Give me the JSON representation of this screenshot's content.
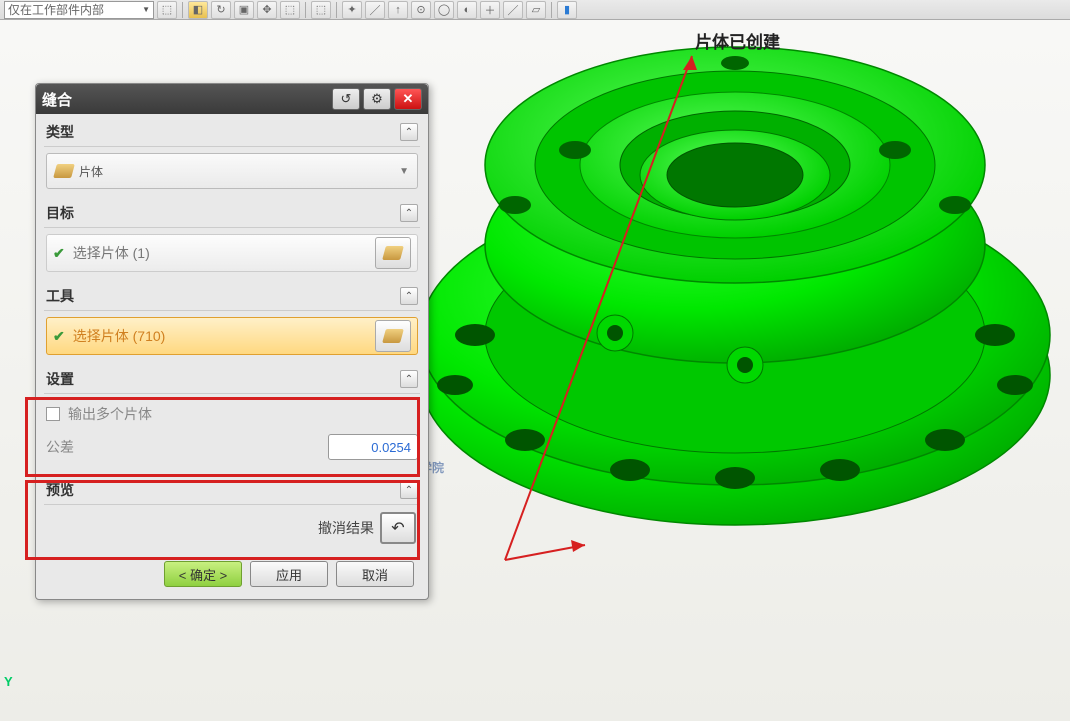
{
  "toolbar": {
    "dropdown_text": "仅在工作部件内部"
  },
  "viewport": {
    "status_text": "片体已创建",
    "axis_label": "Y"
  },
  "dialog": {
    "title": "缝合",
    "sections": {
      "type": {
        "label": "类型",
        "value": "片体"
      },
      "target": {
        "label": "目标",
        "select_text": "选择片体 (1)"
      },
      "tool": {
        "label": "工具",
        "select_text": "选择片体 (710)"
      },
      "settings": {
        "label": "设置",
        "checkbox_label": "输出多个片体",
        "tolerance_label": "公差",
        "tolerance_value": "0.0254"
      },
      "preview": {
        "label": "预览",
        "undo_label": "撤消结果"
      }
    },
    "buttons": {
      "ok": "< 确定 >",
      "apply": "应用",
      "cancel": "取消"
    }
  },
  "watermark": {
    "text": "青华模具学院"
  }
}
